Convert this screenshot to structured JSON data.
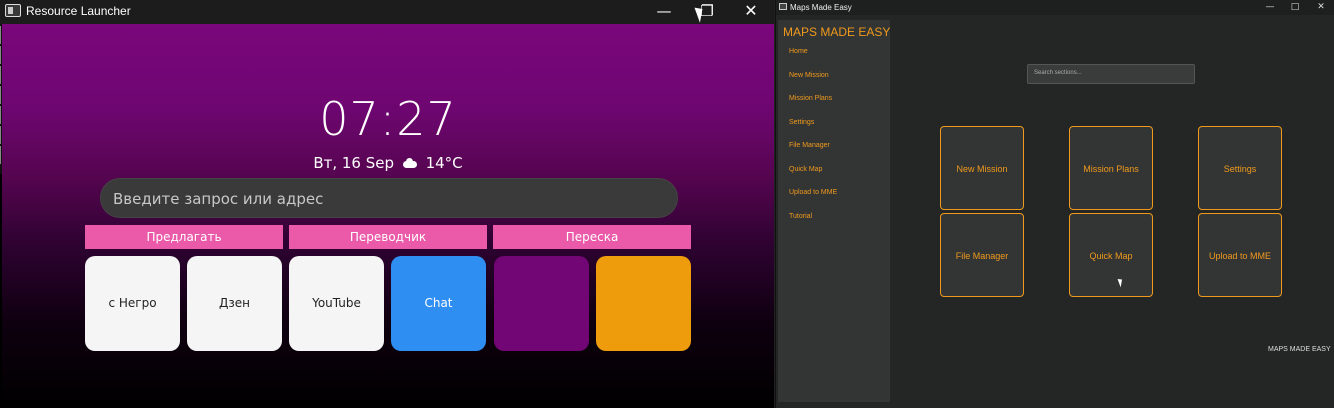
{
  "launcher": {
    "title": "Resource Launcher",
    "controls": {
      "minimize": "—",
      "maximize": "❐",
      "close": "✕"
    },
    "clock": "07:27",
    "date": "Вт, 16 Sep",
    "temperature": "14°C",
    "weather_icon": "cloud-icon",
    "search_placeholder": "Введите запрос или адрес",
    "quick_buttons": [
      "Предлагать",
      "Переводчик",
      "Переска"
    ],
    "tiles": [
      {
        "label": "с Негро",
        "color": "#f5f5f5"
      },
      {
        "label": "Дзен",
        "color": "#f5f5f5"
      },
      {
        "label": "YouTube",
        "color": "#f5f5f5"
      },
      {
        "label": "Chat",
        "color": "#2f8ef2"
      },
      {
        "label": "",
        "color": "#720675"
      },
      {
        "label": "",
        "color": "#ee9b0c"
      }
    ],
    "colors": {
      "gradient_top": "#7a077c",
      "accent_pink": "#ea5aa8"
    }
  },
  "maps": {
    "title": "Maps Made Easy",
    "controls": {
      "minimize": "—",
      "maximize": "□",
      "close": "✕"
    },
    "brand": "MAPS MADE EASY",
    "nav": [
      "Home",
      "New Mission",
      "Mission Plans",
      "Settings",
      "File Manager",
      "Quick Map",
      "Upload to MME",
      "Tutorial"
    ],
    "search_placeholder": "Search sections...",
    "cards": [
      "New Mission",
      "Mission Plans",
      "Settings",
      "File Manager",
      "Quick Map",
      "Upload to MME"
    ],
    "footer": "MAPS MADE EASY",
    "colors": {
      "accent": "#f09a1c",
      "sidebar": "#333535",
      "background": "#242626"
    }
  }
}
